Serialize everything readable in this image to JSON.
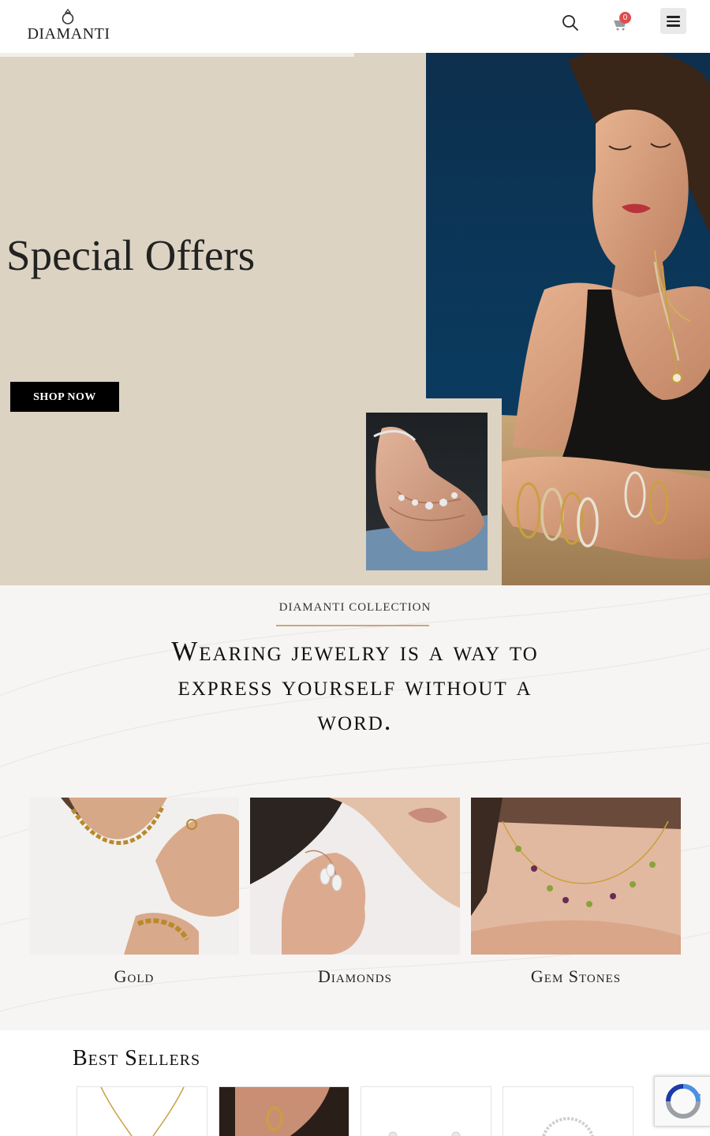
{
  "header": {
    "logo_text": "DIAMANTI",
    "search_icon": "search-icon",
    "cart_icon": "cart-icon",
    "cart_count": "0",
    "menu_icon": "hamburger-menu-icon"
  },
  "hero": {
    "title": "Special Offers",
    "cta_label": "SHOP NOW"
  },
  "collection": {
    "eyebrow": "DIAMANTI COLLECTION",
    "heading": "Wearing jewelry is a way to express yourself without a word.",
    "categories": [
      {
        "label": "Gold"
      },
      {
        "label": "Diamonds"
      },
      {
        "label": "Gem Stones"
      }
    ]
  },
  "best_sellers": {
    "title": "Best Sellers"
  },
  "colors": {
    "hero_bg": "#dcd3c3",
    "accent_gold": "#c6a97a",
    "cart_badge": "#e04c4c"
  }
}
